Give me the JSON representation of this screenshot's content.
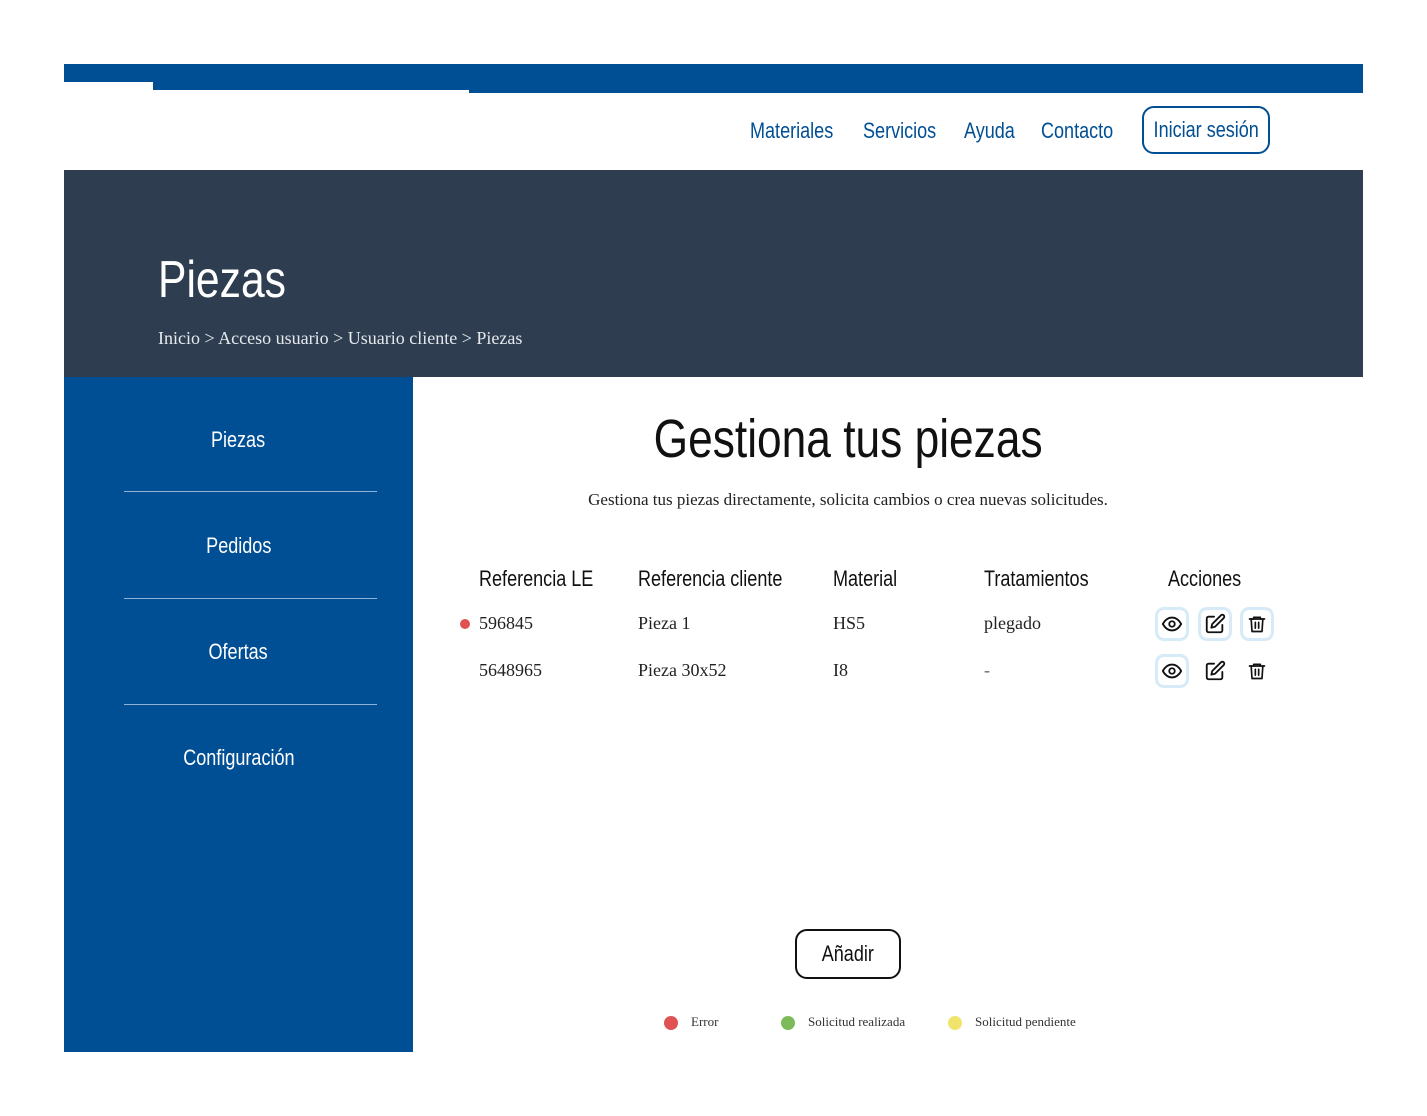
{
  "nav": {
    "items": [
      "Materiales",
      "Servicios",
      "Ayuda",
      "Contacto"
    ],
    "login_label": "Iniciar sesión"
  },
  "hero": {
    "title": "Piezas",
    "breadcrumb": "Inicio > Acceso usuario > Usuario cliente > Piezas"
  },
  "sidebar": {
    "items": [
      "Piezas",
      "Pedidos",
      "Ofertas",
      "Configuración"
    ]
  },
  "main": {
    "title": "Gestiona tus piezas",
    "subtitle": "Gestiona tus piezas directamente, solicita cambios o crea nuevas solicitudes.",
    "table": {
      "headers": [
        "Referencia LE",
        "Referencia cliente",
        "Material",
        "Tratamientos",
        "Acciones"
      ],
      "rows": [
        {
          "status": "error",
          "ref_le": "596845",
          "ref_cliente": "Pieza 1",
          "material": "HS5",
          "tratamientos": "plegado"
        },
        {
          "status": "",
          "ref_le": "5648965",
          "ref_cliente": "Pieza 30x52",
          "material": "I8",
          "tratamientos": "-"
        }
      ]
    },
    "add_label": "Añadir"
  },
  "legend": [
    {
      "label": "Error",
      "color": "#e05252"
    },
    {
      "label": "Solicitud realizada",
      "color": "#7dbb5a"
    },
    {
      "label": "Solicitud pendiente",
      "color": "#f0e46c"
    }
  ],
  "colors": {
    "brand": "#004f95",
    "hero_bg": "#2e3e50",
    "error": "#e05252"
  }
}
